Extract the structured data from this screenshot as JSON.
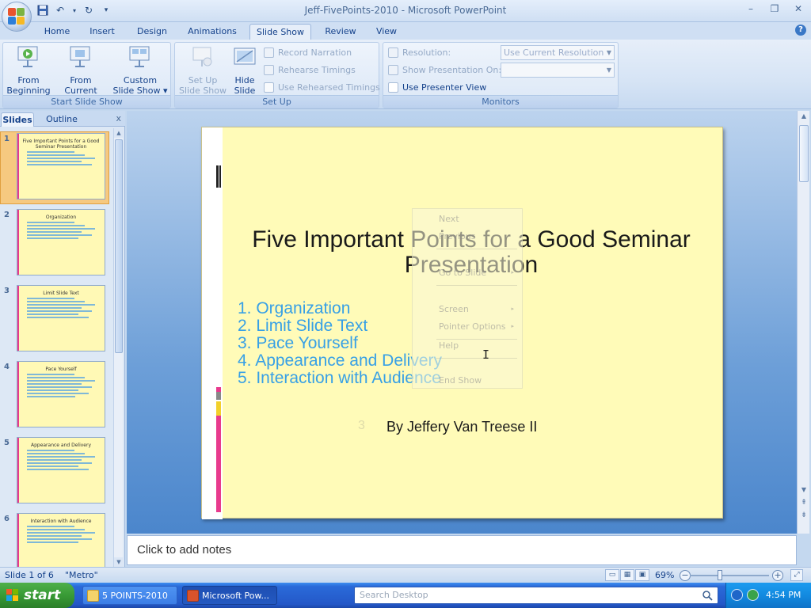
{
  "window": {
    "title": "Jeff-FivePoints-2010 - Microsoft PowerPoint",
    "controls": [
      "–",
      "❐",
      "✕"
    ]
  },
  "qat": {
    "save_icon": "save-icon",
    "undo": "↶",
    "redo": "↻",
    "customize": "▾"
  },
  "tabs": [
    {
      "label": "Home"
    },
    {
      "label": "Insert"
    },
    {
      "label": "Design"
    },
    {
      "label": "Animations"
    },
    {
      "label": "Slide Show"
    },
    {
      "label": "Review"
    },
    {
      "label": "View"
    }
  ],
  "help": "?",
  "ribbon": {
    "start_group": {
      "label": "Start Slide Show",
      "from_beginning": "From\nBeginning",
      "from_current": "From\nCurrent Slide",
      "custom": "Custom\nSlide Show ▾"
    },
    "setup_group": {
      "label": "Set Up",
      "setup_show": "Set Up\nSlide Show",
      "hide_slide": "Hide\nSlide",
      "record_narration": "Record Narration",
      "rehearse_timings": "Rehearse Timings",
      "use_rehearsed": "Use Rehearsed Timings"
    },
    "monitors_group": {
      "label": "Monitors",
      "resolution_label": "Resolution:",
      "resolution_value": "Use Current Resolution",
      "show_on_label": "Show Presentation On:",
      "show_on_value": "",
      "presenter_view": "Use Presenter View"
    }
  },
  "left_pane": {
    "tab_slides": "Slides",
    "tab_outline": "Outline",
    "close": "x",
    "thumbnails": [
      {
        "num": "1",
        "title": "Five Important Points for a Good Seminar Presentation",
        "lines": 5
      },
      {
        "num": "2",
        "title": "Organization",
        "lines": 6
      },
      {
        "num": "3",
        "title": "Limit Slide Text",
        "lines": 7
      },
      {
        "num": "4",
        "title": "Pace Yourself",
        "lines": 8
      },
      {
        "num": "5",
        "title": "Appearance and Delivery",
        "lines": 7
      },
      {
        "num": "6",
        "title": "Interaction with Audience",
        "lines": 6
      }
    ]
  },
  "slide": {
    "title": "Five Important Points for a Good Seminar Presentation",
    "items": [
      "1.  Organization",
      "2.  Limit Slide Text",
      "3.  Pace Yourself",
      "4.  Appearance and Delivery",
      "5.  Interaction with Audience"
    ],
    "author": "By Jeffery Van Treese II",
    "author_faded_num": "3"
  },
  "context_menu": {
    "items": [
      "Next",
      "Previous",
      "Go to Slide",
      "Screen",
      "Pointer Options",
      "Help",
      "End Show"
    ],
    "submenu_arrow": "▸"
  },
  "notes": {
    "placeholder": "Click to add notes"
  },
  "status": {
    "slide_info": "Slide 1 of 6",
    "theme": "\"Metro\"",
    "zoom": "69%",
    "zoom_out": "−",
    "zoom_in": "+",
    "view_normal": "▭",
    "view_sorter": "▦",
    "view_show": "▣"
  },
  "taskbar": {
    "start": "start",
    "buttons": [
      {
        "label": "5 POINTS-2010"
      },
      {
        "label": "Microsoft Pow..."
      }
    ],
    "search_placeholder": "Search Desktop",
    "time": "4:54 PM"
  },
  "colors": {
    "slide_bg": "#fffbb8",
    "bullet_blue": "#37a0e6",
    "accent_pink": "#e83a8d",
    "ribbon_text": "#15428b"
  }
}
